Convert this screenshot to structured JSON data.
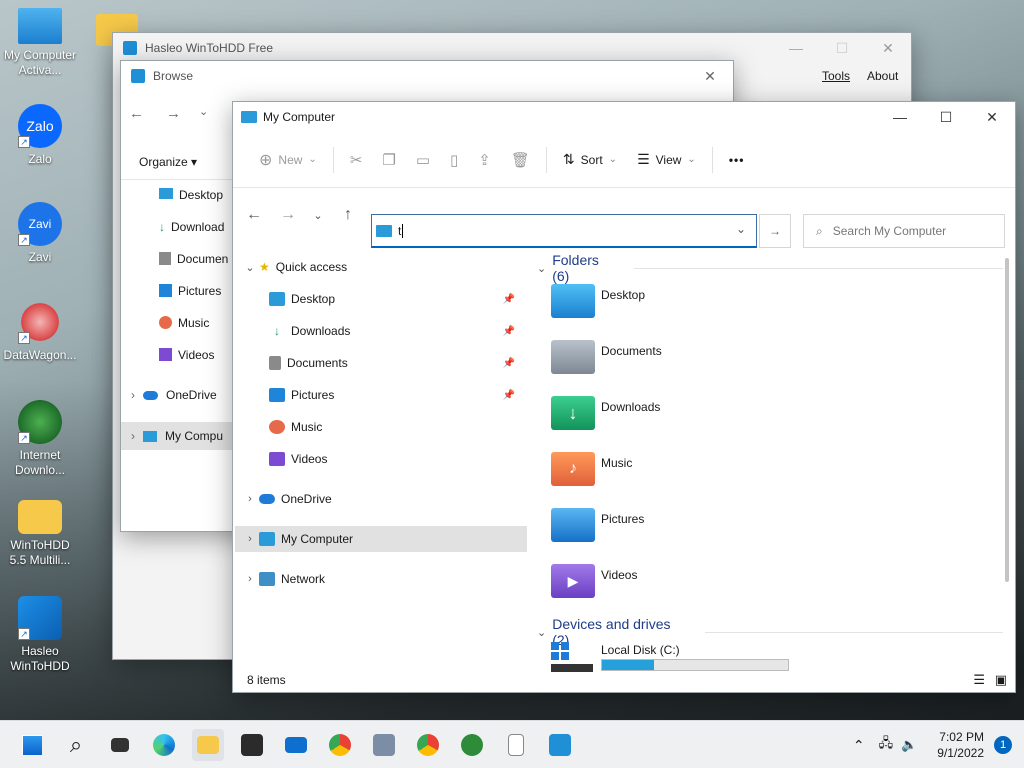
{
  "desktop": {
    "icons": [
      {
        "label": "My Computer Activa..."
      },
      {
        "label": "Zalo"
      },
      {
        "label": "Zavi"
      },
      {
        "label": "DataWagon..."
      },
      {
        "label": "Internet Downlo..."
      },
      {
        "label": "WinToHDD 5.5 Multili..."
      },
      {
        "label": "Hasleo WinToHDD"
      }
    ]
  },
  "wintohdd": {
    "title": "Hasleo WinToHDD Free",
    "menu": [
      "Tools",
      "About"
    ]
  },
  "browse": {
    "title": "Browse",
    "organize_label": "Organize ▾",
    "nav_items": [
      "Desktop",
      "Download",
      "Documen",
      "Pictures",
      "Music",
      "Videos",
      "OneDrive",
      "My Compu"
    ]
  },
  "explorer": {
    "title": "My Computer",
    "toolbar": {
      "new_label": "New",
      "sort_label": "Sort",
      "view_label": "View",
      "more_label": "•••"
    },
    "address": {
      "value": "t"
    },
    "search": {
      "placeholder": "Search My Computer"
    },
    "nav": {
      "quick_access": "Quick access",
      "quick_items": [
        "Desktop",
        "Downloads",
        "Documents",
        "Pictures",
        "Music",
        "Videos"
      ],
      "onedrive": "OneDrive",
      "my_computer": "My Computer",
      "network": "Network"
    },
    "folders_header": "Folders (6)",
    "folders": [
      "Desktop",
      "Documents",
      "Downloads",
      "Music",
      "Pictures",
      "Videos"
    ],
    "drives_header": "Devices and drives (2)",
    "drives": [
      {
        "label": "Local Disk (C:)",
        "used_fraction": 0.28
      }
    ],
    "status": "8 items",
    "colors": {
      "accent": "#0067c0",
      "selected_bg": "#e1e1e1",
      "drive_bar": "#26a0da"
    }
  },
  "taskbar": {
    "time": "7:02 PM",
    "date": "9/1/2022",
    "notifications": "1"
  }
}
